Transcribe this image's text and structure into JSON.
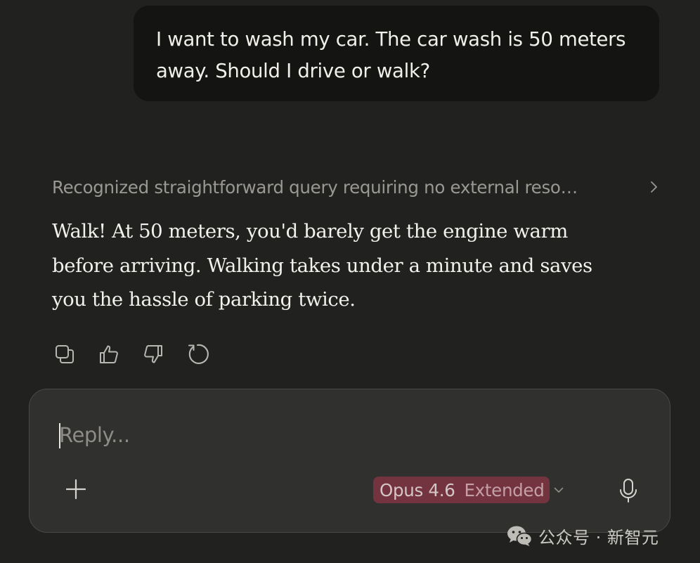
{
  "conversation": {
    "user_message": "I want to wash my car. The car wash is 50 meters away. Should I drive or walk?",
    "thinking_summary": "Recognized straightforward query requiring no external reso…",
    "assistant_message": "Walk! At 50 meters, you'd barely get the engine warm before arriving. Walking takes under a minute and saves you the hassle of parking twice."
  },
  "actions": {
    "icons": [
      "copy-icon",
      "thumbs-up-icon",
      "thumbs-down-icon",
      "retry-icon"
    ]
  },
  "composer": {
    "placeholder": "Reply...",
    "value": "",
    "model_name": "Opus 4.6",
    "model_mode": "Extended",
    "model_pill_color": "#73333f"
  },
  "watermark": {
    "text": "公众号 · 新智元"
  },
  "colors": {
    "background": "#212120",
    "user_bubble": "#141413",
    "composer": "#30302e"
  }
}
